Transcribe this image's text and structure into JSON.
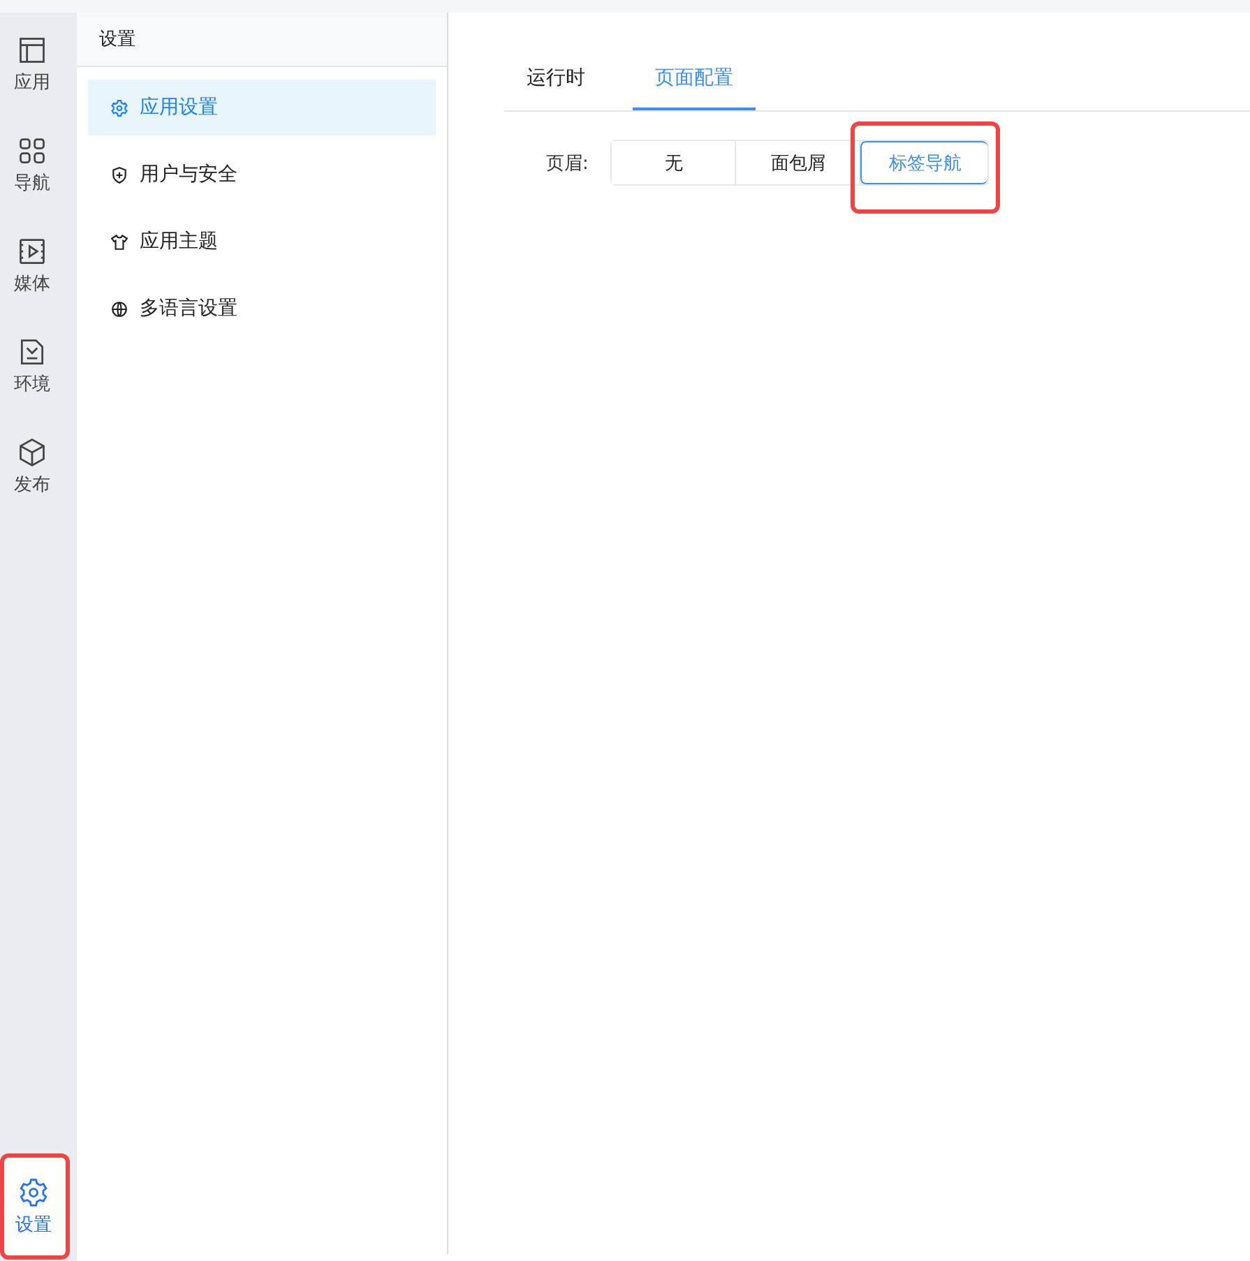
{
  "rail": {
    "items": [
      {
        "label": "应用",
        "kind": "layout",
        "selected": false,
        "highlighted": false
      },
      {
        "label": "导航",
        "kind": "grid",
        "selected": false,
        "highlighted": false
      },
      {
        "label": "媒体",
        "kind": "media",
        "selected": false,
        "highlighted": false
      },
      {
        "label": "环境",
        "kind": "env",
        "selected": false,
        "highlighted": false
      },
      {
        "label": "发布",
        "kind": "cube",
        "selected": false,
        "highlighted": false
      }
    ],
    "bottom": {
      "label": "设置",
      "kind": "gear",
      "selected": true,
      "highlighted": true
    }
  },
  "sidebar": {
    "title": "设置",
    "items": [
      {
        "label": "应用设置",
        "kind": "gear",
        "selected": true
      },
      {
        "label": "用户与安全",
        "kind": "shield",
        "selected": false
      },
      {
        "label": "应用主题",
        "kind": "shirt",
        "selected": false
      },
      {
        "label": "多语言设置",
        "kind": "globe",
        "selected": false
      }
    ]
  },
  "tabs": [
    {
      "label": "运行时",
      "selected": false
    },
    {
      "label": "页面配置",
      "selected": true
    }
  ],
  "header_setting": {
    "label": "页眉:",
    "options": [
      {
        "label": "无",
        "selected": false,
        "highlighted": false
      },
      {
        "label": "面包屑",
        "selected": false,
        "highlighted": false
      },
      {
        "label": "标签导航",
        "selected": true,
        "highlighted": true
      }
    ]
  }
}
